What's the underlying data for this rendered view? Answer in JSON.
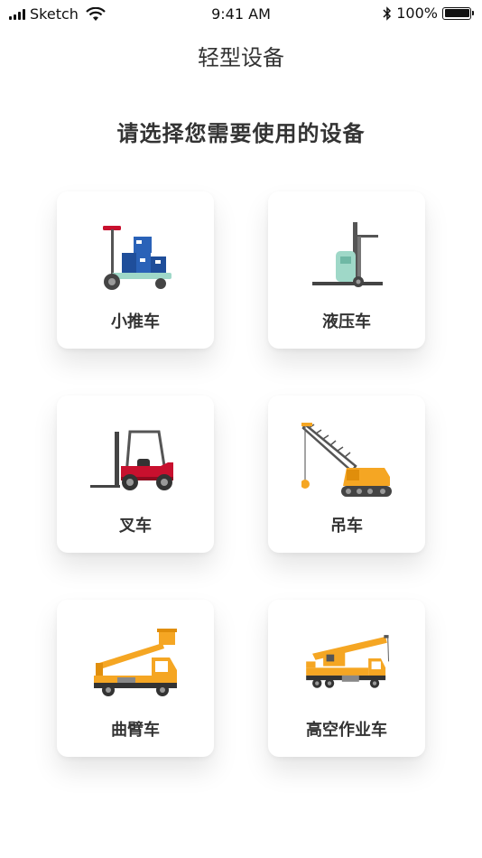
{
  "status_bar": {
    "carrier": "Sketch",
    "time": "9:41 AM",
    "battery": "100%"
  },
  "nav": {
    "title": "轻型设备"
  },
  "prompt": "请选择您需要使用的设备",
  "equipment": [
    {
      "label": "小推车",
      "icon": "hand-cart-icon"
    },
    {
      "label": "液压车",
      "icon": "hydraulic-pallet-truck-icon"
    },
    {
      "label": "叉车",
      "icon": "forklift-icon"
    },
    {
      "label": "吊车",
      "icon": "crawler-crane-icon"
    },
    {
      "label": "曲臂车",
      "icon": "boom-lift-truck-icon"
    },
    {
      "label": "高空作业车",
      "icon": "aerial-work-truck-icon"
    }
  ],
  "colors": {
    "accent_orange": "#F5A623",
    "forklift_red": "#C8102E",
    "pallet_green": "#9FD8C8",
    "box_blue": "#1F4E9A"
  }
}
